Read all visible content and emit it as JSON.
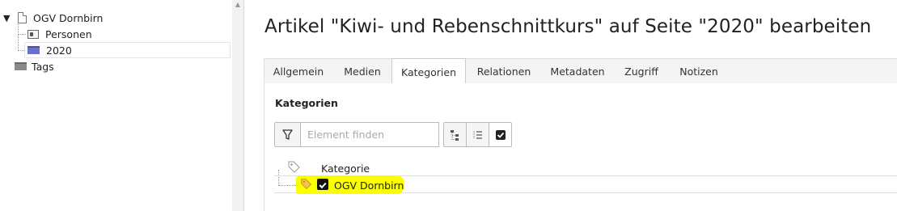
{
  "tree": {
    "root_label": "OGV Dornbirn",
    "toggle_glyph": "▼",
    "items": [
      {
        "label": "Personen",
        "icon": "contact-card-icon"
      },
      {
        "label": "2020",
        "icon": "folder-blue-icon"
      }
    ],
    "tags_label": "Tags"
  },
  "page_title": "Artikel \"Kiwi- und Rebenschnittkurs\" auf Seite \"2020\" bearbeiten",
  "tabs": [
    {
      "label": "Allgemein"
    },
    {
      "label": "Medien"
    },
    {
      "label": "Kategorien"
    },
    {
      "label": "Relationen"
    },
    {
      "label": "Metadaten"
    },
    {
      "label": "Zugriff"
    },
    {
      "label": "Notizen"
    }
  ],
  "active_tab": "Kategorien",
  "panel": {
    "section_label": "Kategorien",
    "filter_placeholder": "Element finden",
    "column_header": "Kategorie",
    "category": {
      "label": "OGV Dornbirn",
      "checked": true
    }
  },
  "colors": {
    "highlight": "#fbff00",
    "folder_blue": "#6b6fcf",
    "tag_icon": "#e8a23a"
  }
}
